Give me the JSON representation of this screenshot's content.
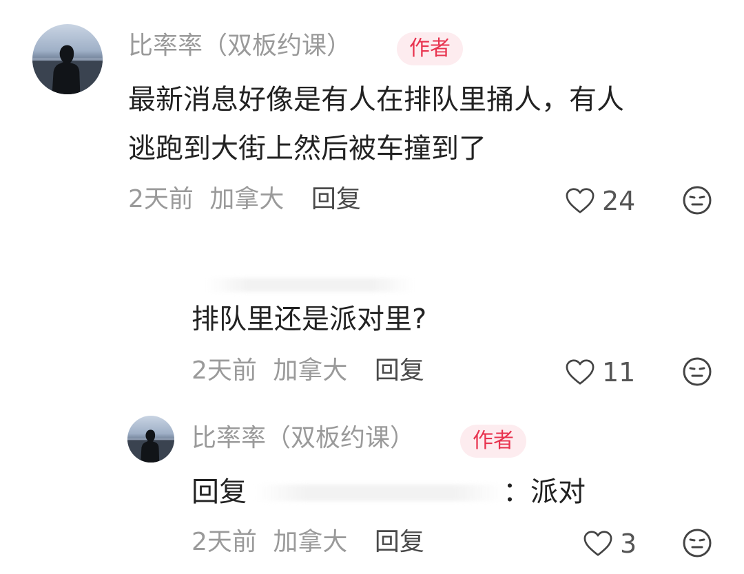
{
  "comment": {
    "author": "比率率（双板约课）",
    "badge": "作者",
    "text_line1": "最新消息好像是有人在排队里捅人，有人",
    "text_line2": "逃跑到大街上然后被车撞到了",
    "time": "2天前",
    "location": "加拿大",
    "reply_label": "回复",
    "likes": "24"
  },
  "reply1": {
    "text": "排队里还是派对里?",
    "time": "2天前",
    "location": "加拿大",
    "reply_label": "回复",
    "likes": "11"
  },
  "reply2": {
    "author": "比率率（双板约课）",
    "badge": "作者",
    "reply_prefix": "回复",
    "text": "：派对",
    "time": "2天前",
    "location": "加拿大",
    "reply_label": "回复",
    "likes": "3"
  },
  "icons": {
    "like": "heart-outline-icon",
    "emoji": "neutral-face-icon"
  },
  "colors": {
    "badge_bg": "#fdecef",
    "badge_text": "#e8334f",
    "meta_text": "#9a9a9a",
    "body_text": "#222222"
  }
}
